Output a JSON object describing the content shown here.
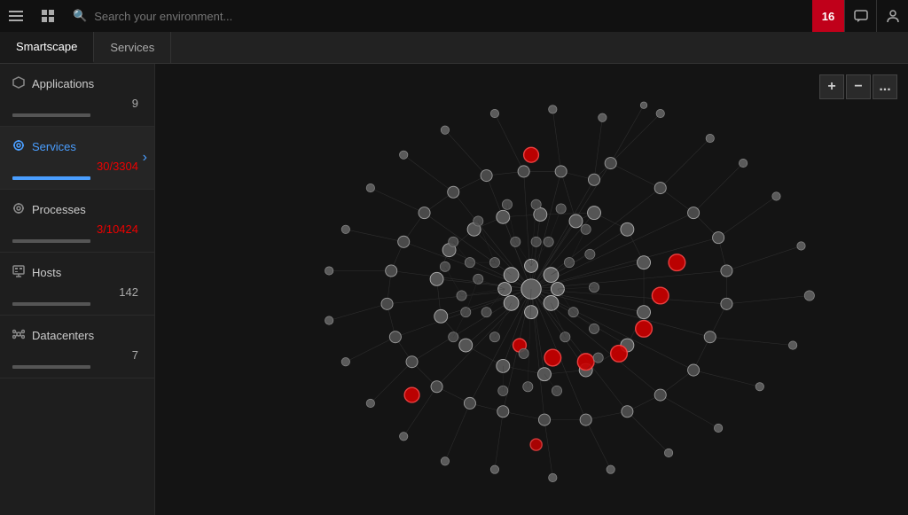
{
  "topbar": {
    "search_placeholder": "Search your environment...",
    "notification_count": "16"
  },
  "navtabs": [
    {
      "label": "Smartscape",
      "active": true
    },
    {
      "label": "Services",
      "active": false
    }
  ],
  "sidebar": {
    "items": [
      {
        "id": "applications",
        "label": "Applications",
        "count": "9",
        "icon": "○",
        "active": false,
        "has_bar": true,
        "count_color": "normal"
      },
      {
        "id": "services",
        "label": "Services",
        "count": "30/3304",
        "icon": "⚙",
        "active": true,
        "has_bar": true,
        "count_color": "red",
        "has_chevron": true
      },
      {
        "id": "processes",
        "label": "Processes",
        "count": "3/10424",
        "icon": "⚙",
        "active": false,
        "has_bar": true,
        "count_color": "red"
      },
      {
        "id": "hosts",
        "label": "Hosts",
        "count": "142",
        "icon": "▦",
        "active": false,
        "has_bar": true,
        "count_color": "normal"
      },
      {
        "id": "datacenters",
        "label": "Datacenters",
        "count": "7",
        "icon": "⊞",
        "active": false,
        "has_bar": true,
        "count_color": "normal"
      }
    ]
  },
  "zoom_controls": {
    "plus_label": "+",
    "minus_label": "−",
    "more_label": "..."
  }
}
